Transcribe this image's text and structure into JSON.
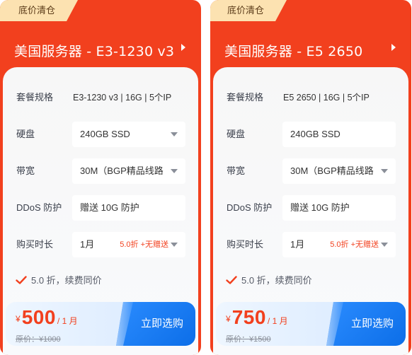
{
  "cards": [
    {
      "badge": "底价清仓",
      "title": "美国服务器 - E3-1230 v3",
      "spec": {
        "label": "套餐规格",
        "value": "E3-1230 v3 | 16G | 5个IP"
      },
      "disk": {
        "label": "硬盘",
        "value": "240GB SSD"
      },
      "bandwidth": {
        "label": "带宽",
        "value": "30M（BGP精品线路"
      },
      "ddos": {
        "label": "DDoS 防护",
        "value": "赠送 10G 防护"
      },
      "term": {
        "label": "购买时长",
        "value": "1月",
        "promo": "5.0折 +无赠送"
      },
      "note": "5.0 折，续费同价",
      "price": {
        "symbol": "¥",
        "amount": "500",
        "per": "/ 1 月",
        "original": "原价：¥1000"
      },
      "buy_label": "立即选购"
    },
    {
      "badge": "底价清仓",
      "title": "美国服务器 - E5 2650",
      "spec": {
        "label": "套餐规格",
        "value": "E5 2650 | 16G | 5个IP"
      },
      "disk": {
        "label": "硬盘",
        "value": "240GB SSD"
      },
      "bandwidth": {
        "label": "带宽",
        "value": "30M（BGP精品线路"
      },
      "ddos": {
        "label": "DDoS 防护",
        "value": "赠送 10G 防护"
      },
      "term": {
        "label": "购买时长",
        "value": "1月",
        "promo": "5.0折 +无赠送"
      },
      "note": "5.0 折，续费同价",
      "price": {
        "symbol": "¥",
        "amount": "750",
        "per": "/ 1 月",
        "original": "原价：¥1500"
      },
      "buy_label": "立即选购"
    }
  ],
  "colors": {
    "brand_red": "#f2401e",
    "badge_gold": "#fce2b1",
    "button_blue": "#1677ff"
  }
}
